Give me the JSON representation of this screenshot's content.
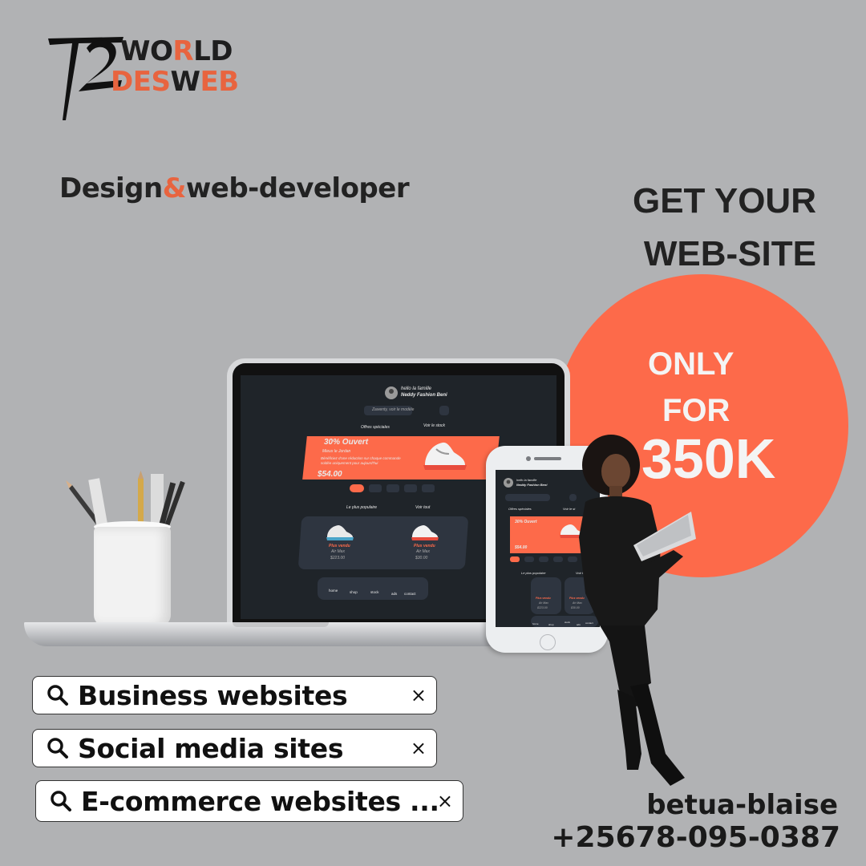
{
  "brand": {
    "line1": {
      "a": "W",
      "b": "O",
      "c": "R",
      "d": "LD"
    },
    "line2": {
      "a": "D",
      "b": "ES",
      "c": "W",
      "d": "EB"
    }
  },
  "tagline": {
    "part1": "Design",
    "amp": "&",
    "part2": "web-developer"
  },
  "headline": {
    "line1": "GET YOUR",
    "line2": "WEB-SITE"
  },
  "promo": {
    "line1": "ONLY",
    "line2": "FOR",
    "price": "350K"
  },
  "laptop_site": {
    "greeting1": "hello la famille",
    "greeting2": "Neddy Fashion Beni",
    "search_placeholder": "Zawenty, voir le modèle",
    "offers_label": "Offres spéciales",
    "stock_label": "Voir le stock",
    "banner_title": "30% Ouvert",
    "banner_sub": "Mieux le Jordan",
    "banner_desc1": "Bénéficiez d'une réduction sur chaque commande",
    "banner_desc2": "soldée uniquement pour aujourd'hui",
    "banner_price": "$54.00",
    "popular_label": "Le plus populaire",
    "see_all": "Voir tout",
    "product1": {
      "tag": "Plus vendu",
      "name": "Air Max",
      "price": "$223.00"
    },
    "product2": {
      "tag": "Plus vendu",
      "name": "Air Max",
      "price": "$30.00"
    },
    "nav": [
      "home",
      "shop",
      "stock",
      "ads",
      "contact"
    ]
  },
  "phone_site": {
    "greeting1": "hello la famille",
    "greeting2": "Neddy Fashion Beni",
    "offers_label": "Offres spéciales",
    "stock_label": "Voir le st",
    "banner_title": "30% Ouvert",
    "banner_price": "$54.00",
    "popular_label": "Le plus populaire",
    "see_all": "Voir tout",
    "product1": {
      "tag": "Plus vendu",
      "name": "Air Max",
      "price": "$223.00"
    },
    "product2": {
      "tag": "Plus vendu",
      "name": "Air Max",
      "price": "$30.00"
    },
    "nav": [
      "home",
      "shop",
      "stock",
      "ads",
      "contact"
    ]
  },
  "chips": [
    {
      "label": "Business websites",
      "close": "×"
    },
    {
      "label": "Social media sites",
      "close": "×"
    },
    {
      "label": "E-commerce websites ...",
      "close": "×"
    }
  ],
  "contact": {
    "name": "betua-blaise",
    "phone": "+25678-095-0387"
  },
  "colors": {
    "accent": "#fd6a4a",
    "background": "#b1b2b4",
    "text": "#222222",
    "screen": "#1f2429"
  },
  "icons": [
    "logo-mark-icon",
    "search-icon",
    "close-icon",
    "shoe-icon",
    "avatar-icon",
    "home-icon",
    "shop-icon",
    "stock-icon",
    "ads-icon",
    "contact-icon"
  ]
}
